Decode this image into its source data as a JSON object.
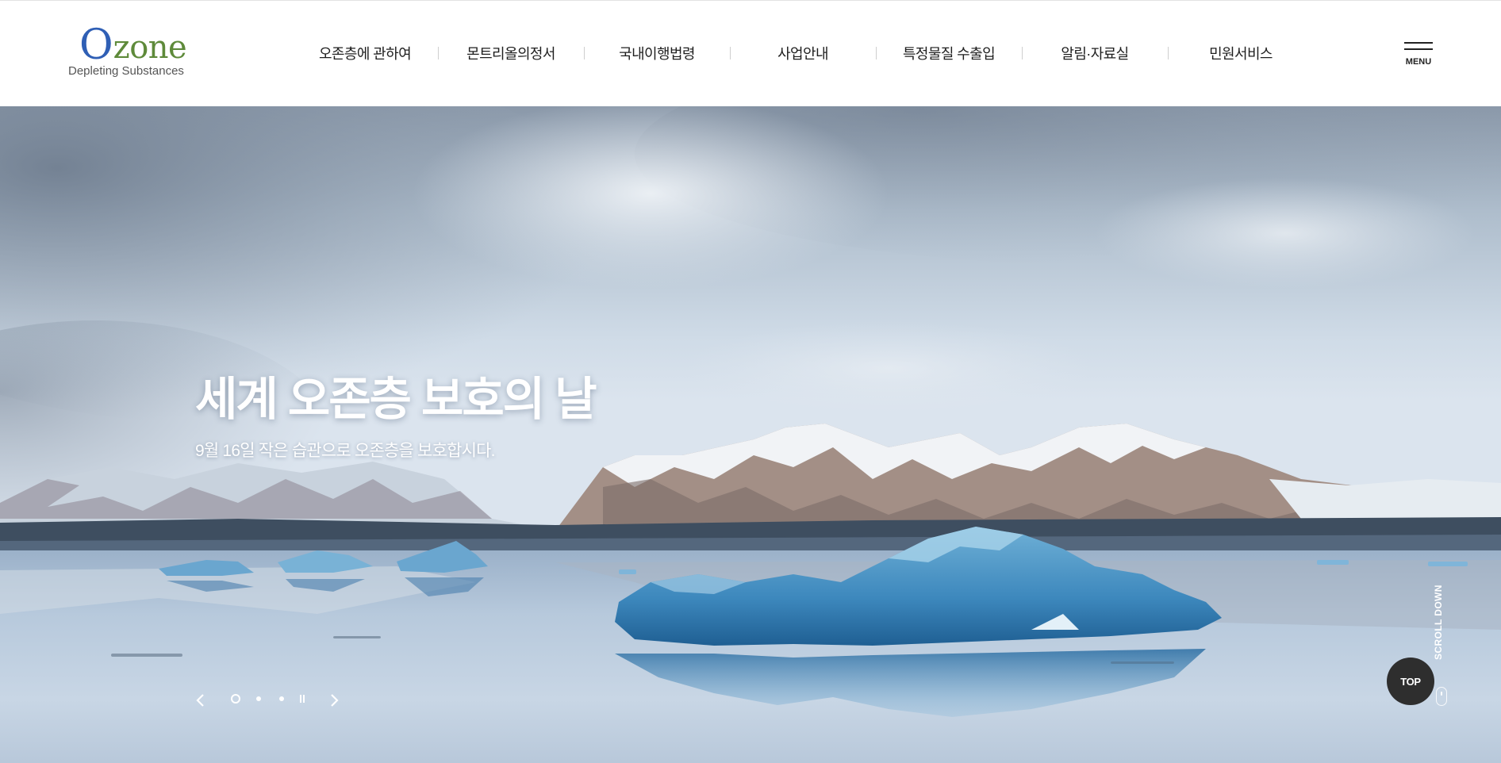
{
  "header": {
    "logo": {
      "initial": "O",
      "rest": "zone",
      "tagline": "Depleting Substances",
      "colors": {
        "initial": "#2f5fb5",
        "rest": "#5e8a3a"
      }
    },
    "nav": [
      {
        "label": "오존층에 관하여"
      },
      {
        "label": "몬트리올의정서"
      },
      {
        "label": "국내이행법령"
      },
      {
        "label": "사업안내"
      },
      {
        "label": "특정물질 수출입"
      },
      {
        "label": "알림·자료실"
      },
      {
        "label": "민원서비스"
      }
    ],
    "menu": {
      "label": "MENU",
      "icon": "hamburger-icon"
    }
  },
  "hero": {
    "title": "세계 오존층 보호의 날",
    "subtitle": "9월 16일 작은 습관으로 오존층을 보호합시다.",
    "slider": {
      "current_slide": 1,
      "total_slides": 3,
      "controls": [
        "chevron-left-icon",
        "chevron-right-icon",
        "pause-icon"
      ]
    },
    "scroll_label": "SCROLL DOWN",
    "scroll_icon": "mouse-icon",
    "top_label": "TOP"
  },
  "colors": {
    "text_dark": "#1e1e1e",
    "top_button": "#2e2e2e",
    "hero_text": "#ffffff"
  }
}
